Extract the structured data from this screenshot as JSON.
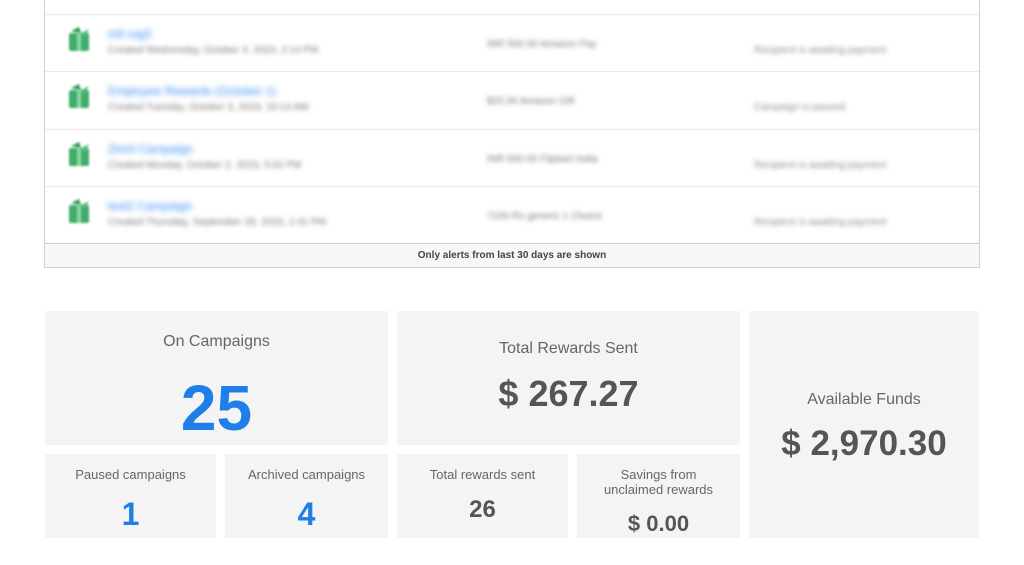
{
  "alerts": {
    "rows": [
      {
        "name": "Intl reg3",
        "created": "Created Wednesday, October 4, 2023, 2:14 PM",
        "amount": "INR 500.00 Amazon Pay",
        "status": "Recipient is awaiting payment"
      },
      {
        "name": "Employee Rewards (October 1)",
        "created": "Created Tuesday, October 3, 2023, 10:14 AM",
        "amount": "$25.00 Amazon Gift",
        "status": "Campaign is paused"
      },
      {
        "name": "Zinrit Campaign",
        "created": "Created Monday, October 2, 2023, 5:02 PM",
        "amount": "INR 500.00 Flipkart India",
        "status": "Recipient is awaiting payment"
      },
      {
        "name": "test2 Campaign",
        "created": "Created Thursday, September 28, 2023, 1:41 PM",
        "amount": "7100 Rs generic 1 Choice",
        "status": "Recipient is awaiting payment"
      }
    ],
    "footer": "Only alerts from last 30 days are shown"
  },
  "stats": {
    "campaigns": {
      "label": "On Campaigns",
      "value": "25"
    },
    "rewards_sent_total": {
      "label": "Total Rewards Sent",
      "value": "$ 267.27"
    },
    "available_funds": {
      "label": "Available Funds",
      "value": "$ 2,970.30"
    },
    "paused": {
      "label": "Paused campaigns",
      "value": "1"
    },
    "archived": {
      "label": "Archived campaigns",
      "value": "4"
    },
    "total_sent_count": {
      "label": "Total rewards sent",
      "value": "26"
    },
    "savings": {
      "label_line1": "Savings from",
      "label_line2": "unclaimed rewards",
      "value": "$ 0.00"
    }
  },
  "colors": {
    "accent_blue": "#1e7fe8",
    "link_blue": "#2f8bf0",
    "icon_green": "#3fae6a",
    "card_bg": "#f4f4f4"
  }
}
